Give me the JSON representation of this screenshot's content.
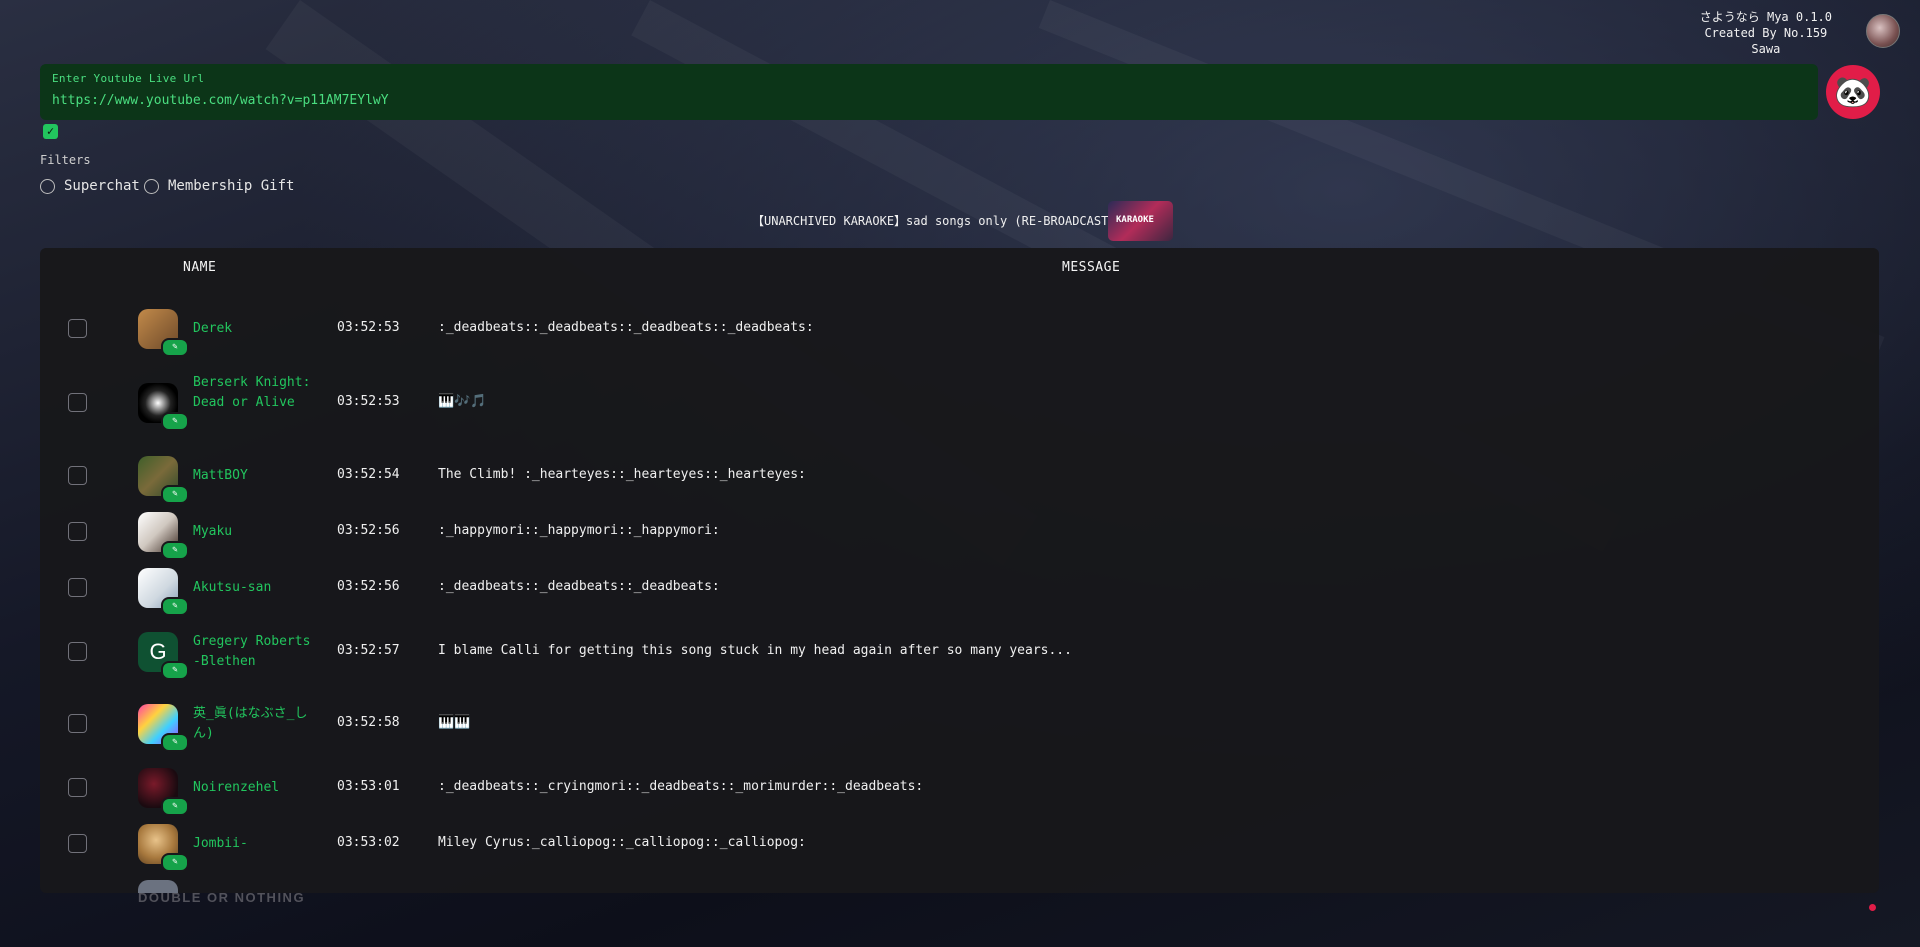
{
  "app": {
    "title_line1": "さようなら Mya 0.1.0",
    "title_line2": "Created By No.159",
    "title_line3": "Sawa"
  },
  "url_field": {
    "label": "Enter Youtube Live Url",
    "value": "https://www.youtube.com/watch?v=p11AM7EYlwY"
  },
  "filters": {
    "label": "Filters",
    "superchat": "Superchat",
    "membership": "Membership Gift"
  },
  "stream": {
    "title": "【UNARCHIVED KARAOKE】sad songs only (RE-BROADCAST)",
    "thumb_text": "KARAOKE"
  },
  "table": {
    "col_name": "NAME",
    "col_message": "MESSAGE",
    "rows": [
      {
        "name": "Derek",
        "time": "03:52:53",
        "message": ":_deadbeats::_deadbeats::_deadbeats::_deadbeats:"
      },
      {
        "name": "Berserk Knight: Dead or Alive",
        "time": "03:52:53",
        "message": "🎹🎶🎵"
      },
      {
        "name": "MattBOY",
        "time": "03:52:54",
        "message": "The Climb! :_hearteyes::_hearteyes::_hearteyes:"
      },
      {
        "name": "Myaku",
        "time": "03:52:56",
        "message": ":_happymori::_happymori::_happymori:"
      },
      {
        "name": "Akutsu-san",
        "time": "03:52:56",
        "message": ":_deadbeats::_deadbeats::_deadbeats:"
      },
      {
        "name": "Gregery Roberts-Blethen",
        "time": "03:52:57",
        "message": "I blame Calli for getting this song stuck in my head again after so many years..."
      },
      {
        "name": "英_眞(はなぶさ_しん)",
        "time": "03:52:58",
        "message": "🎹🎹"
      },
      {
        "name": "Noirenzehel",
        "time": "03:53:01",
        "message": ":_deadbeats::_cryingmori::_deadbeats::_morimurder::_deadbeats:"
      },
      {
        "name": "Jombii-",
        "time": "03:53:02",
        "message": "Miley Cyrus:_calliopog::_calliopog::_calliopog:"
      }
    ]
  },
  "avatar_letter": "G",
  "background_text": "DOUBLE OR NOTHING",
  "colors": {
    "accent": "#22c55e",
    "url_bg": "#0c3518",
    "panda": "#e11d48",
    "table_bg": "#18181b"
  }
}
